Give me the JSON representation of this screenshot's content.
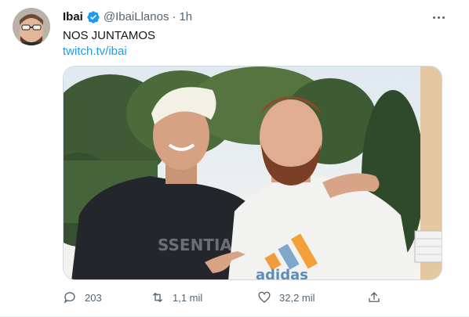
{
  "tweet": {
    "author_name": "Ibai",
    "author_handle": "@IbaiLlanos",
    "separator": "·",
    "time": "1h",
    "text": "NOS JUNTAMOS",
    "link_text": "twitch.tv/ibai",
    "shirt_text_left": "SSENTIA",
    "shirt_text_right": "adidas"
  },
  "actions": {
    "replies": "203",
    "retweets": "1,1 mil",
    "likes": "32,2 mil"
  },
  "icons": {
    "verified": "verified-badge-icon",
    "more": "more-horizontal-icon",
    "reply": "reply-icon",
    "retweet": "retweet-icon",
    "like": "heart-icon",
    "share": "share-icon"
  },
  "colors": {
    "accent": "#1d9bf0",
    "text": "#0f1419",
    "secondary": "#536471"
  }
}
